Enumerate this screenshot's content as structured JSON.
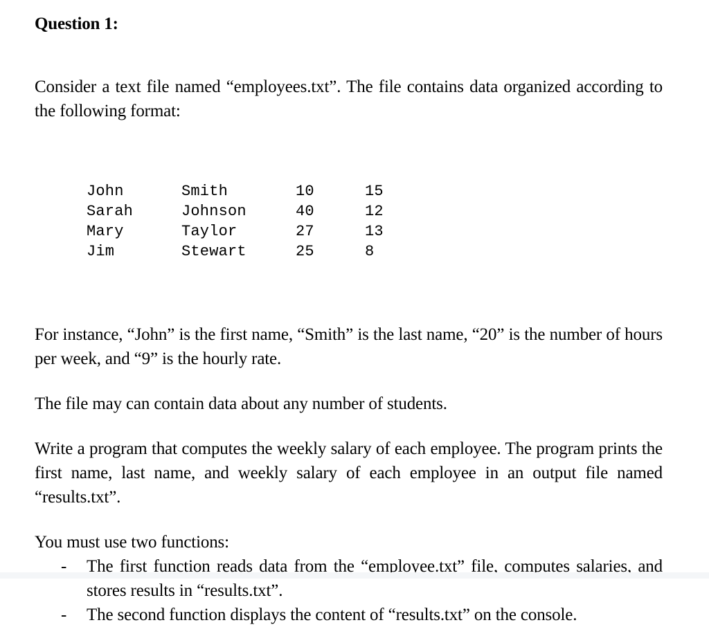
{
  "document": {
    "title": "Question 1:",
    "intro_paragraph": "Consider a text file named “employees.txt”.  The file contains data organized according to the following format:",
    "data_table": {
      "rows": [
        {
          "first_name": "John",
          "last_name": "Smith",
          "hours": "10",
          "rate": "15"
        },
        {
          "first_name": "Sarah",
          "last_name": "Johnson",
          "hours": "40",
          "rate": "12"
        },
        {
          "first_name": "Mary",
          "last_name": "Taylor",
          "hours": "27",
          "rate": "13"
        },
        {
          "first_name": "Jim",
          "last_name": "Stewart",
          "hours": "25",
          "rate": "8"
        }
      ]
    },
    "instance_paragraph": "For instance, “John” is the first name, “Smith” is the last name, “20” is the number of hours per week, and “9” is the hourly rate.",
    "file_note_paragraph": "The file may can contain data about any number of students.",
    "task_paragraph": "Write a program that computes the weekly salary of each employee. The program prints the first name, last name, and weekly salary of each employee in an output file named “results.txt”.",
    "functions_heading": "You must use two functions:",
    "function_list": {
      "marker": "-",
      "items": [
        "The first function reads data from the “employee.txt” file, computes salaries, and stores results in “results.txt”.",
        "The second function displays the content of “results.txt” on the console."
      ]
    }
  },
  "colors": {
    "page_background": "#ffffff",
    "text": "#000000",
    "bottom_tint": "#f4f6f8"
  }
}
